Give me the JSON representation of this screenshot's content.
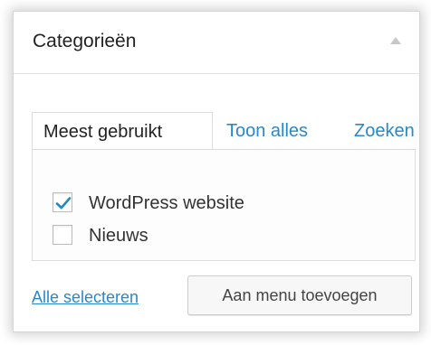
{
  "panel": {
    "title": "Categorieën",
    "collapse_icon": "triangle-up-icon"
  },
  "tabs": [
    {
      "label": "Meest gebruikt",
      "active": true
    },
    {
      "label": "Toon alles",
      "active": false
    },
    {
      "label": "Zoeken",
      "active": false
    }
  ],
  "categories": [
    {
      "label": "WordPress website",
      "checked": true
    },
    {
      "label": "Nieuws",
      "checked": false
    }
  ],
  "footer": {
    "select_all_label": "Alle selecteren",
    "add_button_label": "Aan menu toevoegen"
  },
  "colors": {
    "link": "#2a88c9",
    "check": "#1e8cbe"
  }
}
